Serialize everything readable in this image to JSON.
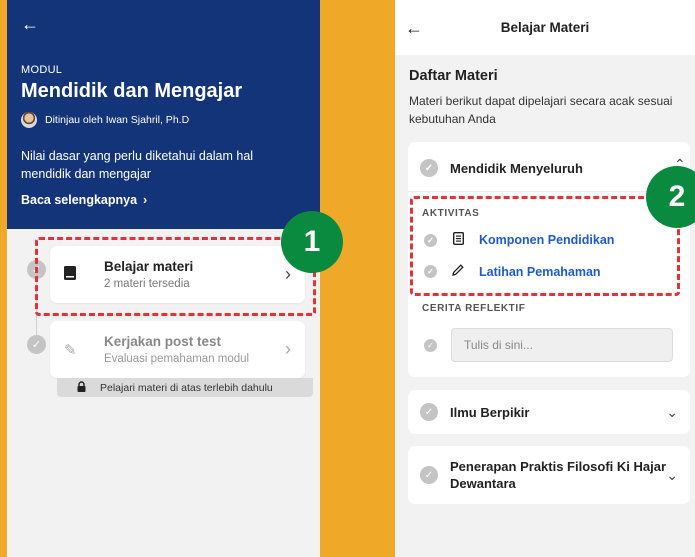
{
  "left": {
    "modul_label": "MODUL",
    "modul_title": "Mendidik dan Mengajar",
    "reviewer": "Ditinjau oleh Iwan Sjahril, Ph.D",
    "description": "Nilai dasar yang perlu diketahui dalam hal mendidik dan mengajar",
    "read_more": "Baca selengkapnya",
    "cards": [
      {
        "title": "Belajar materi",
        "subtitle": "2 materi tersedia"
      },
      {
        "title": "Kerjakan post test",
        "subtitle": "Evaluasi pemahaman modul"
      }
    ],
    "locked_note": "Pelajari materi di atas terlebih dahulu"
  },
  "right": {
    "header_title": "Belajar Materi",
    "section_title": "Daftar Materi",
    "section_desc": "Materi berikut dapat dipelajari secara acak sesuai kebutuhan Anda",
    "open_section_title": "Mendidik Menyeluruh",
    "aktivitas_label": "AKTIVITAS",
    "activities": [
      "Komponen Pendidikan",
      "Latihan Pemahaman"
    ],
    "cerita_label": "CERITA REFLEKTIF",
    "reflection_placeholder": "Tulis di sini...",
    "collapsed_sections": [
      "Ilmu Berpikir",
      "Penerapan Praktis Filosofi Ki Hajar Dewantara"
    ]
  },
  "badges": [
    "1",
    "2"
  ],
  "colors": {
    "background": "#F0A829",
    "hero": "#14347A",
    "link": "#1F5AD2",
    "highlight": "#E53238",
    "badge": "#0A8A3F"
  },
  "icons": {
    "back": "back-arrow-icon",
    "book": "book-icon",
    "pencil": "pencil-icon",
    "lock": "lock-icon",
    "document": "document-icon",
    "check": "check-icon",
    "chevron": "chevron-icon"
  }
}
